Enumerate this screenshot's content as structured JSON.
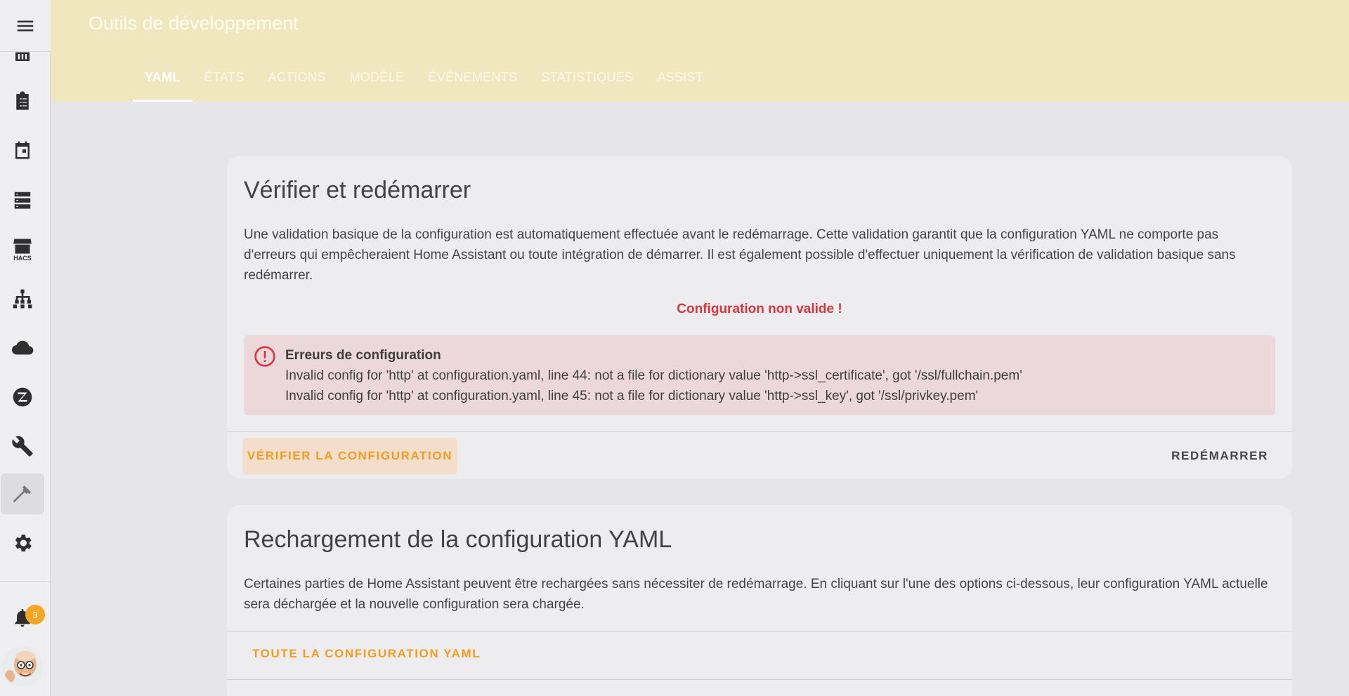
{
  "header": {
    "title": "Outils de développement",
    "tabs": [
      {
        "label": "YAML"
      },
      {
        "label": "ÉTATS"
      },
      {
        "label": "ACTIONS"
      },
      {
        "label": "MODÈLE"
      },
      {
        "label": "ÉVÉNEMENTS"
      },
      {
        "label": "STATISTIQUES"
      },
      {
        "label": "ASSIST"
      }
    ],
    "active_tab": "YAML"
  },
  "sidebar": {
    "items": [
      {
        "icon": "energy-icon"
      },
      {
        "icon": "todo-list-icon"
      },
      {
        "icon": "calendar-icon"
      },
      {
        "icon": "server-icon"
      },
      {
        "icon": "hacs-store-icon",
        "label": "HACS"
      },
      {
        "icon": "network-icon"
      },
      {
        "icon": "cloud-icon"
      },
      {
        "icon": "zwave-icon"
      },
      {
        "icon": "wrench-icon"
      },
      {
        "icon": "hammer-icon"
      },
      {
        "icon": "gear-icon"
      }
    ],
    "active_item": "hammer-icon",
    "notifications_count": "3"
  },
  "check_card": {
    "title": "Vérifier et redémarrer",
    "description": "Une validation basique de la configuration est automatiquement effectuée avant le redémarrage. Cette validation garantit que la configuration YAML ne comporte pas d'erreurs qui empêcheraient Home Assistant ou toute intégration de démarrer. Il est également possible d'effectuer uniquement la vérification de validation basique sans redémarrer.",
    "status": "Configuration non valide !",
    "alert": {
      "title": "Erreurs de configuration",
      "lines": [
        "Invalid config for 'http' at configuration.yaml, line 44: not a file for dictionary value 'http->ssl_certificate', got '/ssl/fullchain.pem'",
        "Invalid config for 'http' at configuration.yaml, line 45: not a file for dictionary value 'http->ssl_key', got '/ssl/privkey.pem'"
      ]
    },
    "check_button": "VÉRIFIER LA CONFIGURATION",
    "restart_button": "REDÉMARRER"
  },
  "reload_card": {
    "title": "Rechargement de la configuration YAML",
    "description": "Certaines parties de Home Assistant peuvent être rechargées sans nécessiter de redémarrage. En cliquant sur l'une des options ci-dessous, leur configuration YAML actuelle sera déchargée et la nouvelle configuration sera chargée.",
    "all_yaml_button": "TOUTE LA CONFIGURATION YAML"
  },
  "colors": {
    "header_bg": "#f1e7bf",
    "accent": "#f39c1f",
    "error": "#d9363e",
    "alert_bg": "#ecd7da",
    "badge": "#f5a623"
  }
}
